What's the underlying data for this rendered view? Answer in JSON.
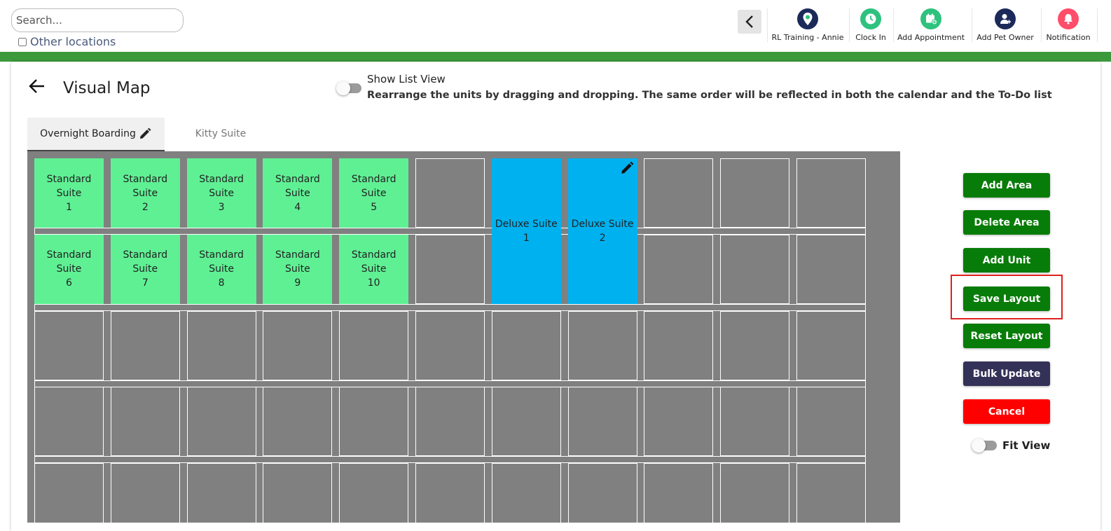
{
  "search": {
    "placeholder": "Search...",
    "value": ""
  },
  "other_locations": {
    "label": "Other locations",
    "checked": false
  },
  "toolbar": {
    "items": [
      {
        "label": "RL Training - Annie",
        "icon": "location-pin-icon",
        "color": "#1c2a5a"
      },
      {
        "label": "Clock In",
        "icon": "clock-icon",
        "color": "#2ec27e"
      },
      {
        "label": "Add Appointment",
        "icon": "calendar-add-icon",
        "color": "#2ec27e"
      },
      {
        "label": "Add Pet Owner",
        "icon": "user-add-icon",
        "color": "#1c2a5a"
      },
      {
        "label": "Notification",
        "icon": "bell-icon",
        "color": "#ff4d6a"
      }
    ]
  },
  "page": {
    "title": "Visual Map",
    "list_view_label": "Show List View",
    "list_view_hint": "Rearrange the units by dragging and dropping. The same order will be reflected in both the calendar and the To-Do list",
    "list_view_on": false
  },
  "tabs": [
    {
      "label": "Overnight Boarding",
      "active": true
    },
    {
      "label": "Kitty Suite",
      "active": false
    }
  ],
  "map": {
    "grid_columns": 11,
    "grid_rows": 5,
    "units": [
      {
        "name": "Standard Suite\n1",
        "type": "standard"
      },
      {
        "name": "Standard Suite\n2",
        "type": "standard"
      },
      {
        "name": "Standard Suite\n3",
        "type": "standard"
      },
      {
        "name": "Standard Suite\n4",
        "type": "standard"
      },
      {
        "name": "Standard Suite\n5",
        "type": "standard"
      },
      {
        "name": "Standard Suite\n6",
        "type": "standard"
      },
      {
        "name": "Standard Suite\n7",
        "type": "standard"
      },
      {
        "name": "Standard Suite\n8",
        "type": "standard"
      },
      {
        "name": "Standard Suite\n9",
        "type": "standard"
      },
      {
        "name": "Standard Suite\n10",
        "type": "standard"
      },
      {
        "name": "Deluxe Suite 1",
        "type": "deluxe"
      },
      {
        "name": "Deluxe Suite 2",
        "type": "deluxe"
      }
    ],
    "colors": {
      "standard": "#5ff094",
      "deluxe": "#00b1ef",
      "background": "#808080"
    }
  },
  "actions": {
    "add_area": "Add Area",
    "delete_area": "Delete Area",
    "add_unit": "Add Unit",
    "save_layout": "Save Layout",
    "reset_layout": "Reset Layout",
    "bulk_update": "Bulk Update",
    "cancel": "Cancel",
    "fit_view": "Fit View",
    "fit_view_on": false
  }
}
